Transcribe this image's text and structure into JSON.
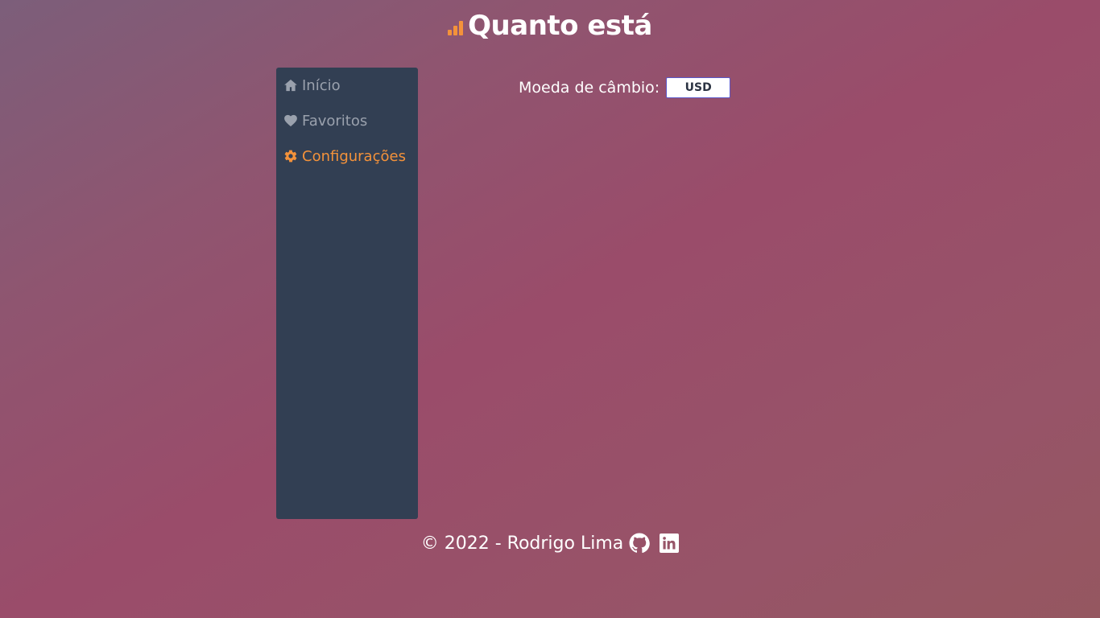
{
  "header": {
    "title": "Quanto está",
    "logo_icon": "bar-chart-icon",
    "accent_color": "#f4923a"
  },
  "sidebar": {
    "items": [
      {
        "label": "Início",
        "icon": "home-icon",
        "active": false
      },
      {
        "label": "Favoritos",
        "icon": "heart-icon",
        "active": false
      },
      {
        "label": "Configurações",
        "icon": "gear-icon",
        "active": true
      }
    ]
  },
  "main": {
    "currency_label": "Moeda de câmbio:",
    "currency_value": "USD"
  },
  "footer": {
    "text": "© 2022 - Rodrigo Lima",
    "links": [
      {
        "icon": "github-icon"
      },
      {
        "icon": "linkedin-icon"
      }
    ]
  }
}
